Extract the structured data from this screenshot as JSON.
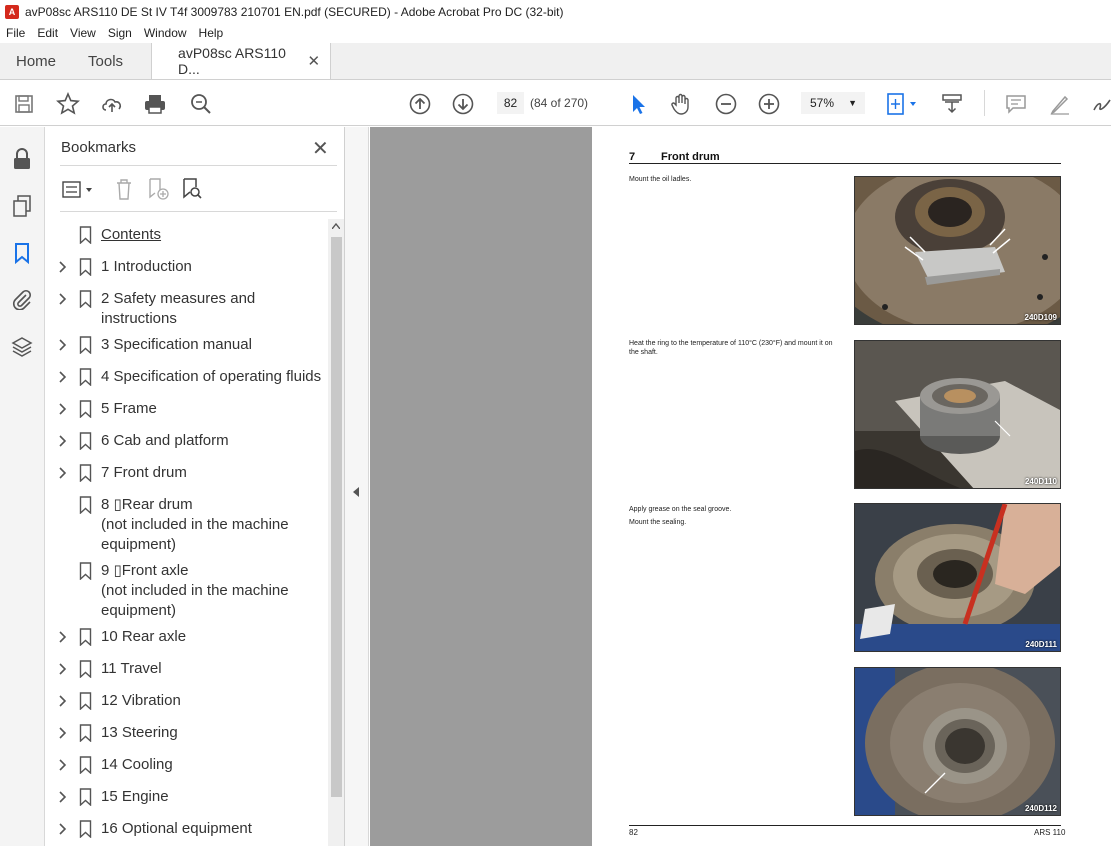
{
  "window": {
    "title": "avP08sc ARS110 DE St IV T4f 3009783 210701 EN.pdf (SECURED) - Adobe Acrobat Pro DC (32-bit)"
  },
  "menu": [
    "File",
    "Edit",
    "View",
    "Sign",
    "Window",
    "Help"
  ],
  "tabs": {
    "home": "Home",
    "tools": "Tools",
    "document": "avP08sc ARS110 D..."
  },
  "toolbar": {
    "page_number": "82",
    "page_count": "(84 of 270)",
    "zoom": "57%"
  },
  "bookmarks": {
    "title": "Bookmarks",
    "items": [
      {
        "label": "Contents",
        "expandable": false,
        "underline": true
      },
      {
        "label": "1 Introduction",
        "expandable": true
      },
      {
        "label": "2 Safety measures and\ninstructions",
        "expandable": true
      },
      {
        "label": "3 Specification manual",
        "expandable": true
      },
      {
        "label": "4 Specification of operating fluids",
        "expandable": true
      },
      {
        "label": "5 Frame",
        "expandable": true
      },
      {
        "label": "6 Cab and platform",
        "expandable": true
      },
      {
        "label": "7 Front drum",
        "expandable": true
      },
      {
        "label": "8 ▯Rear drum\n(not included in the machine\nequipment)",
        "expandable": false
      },
      {
        "label": "9 ▯Front axle\n(not included in the machine\nequipment)",
        "expandable": false
      },
      {
        "label": "10 Rear axle",
        "expandable": true
      },
      {
        "label": "11 Travel",
        "expandable": true
      },
      {
        "label": "12 Vibration",
        "expandable": true
      },
      {
        "label": "13 Steering",
        "expandable": true
      },
      {
        "label": "14 Cooling",
        "expandable": true
      },
      {
        "label": "15 Engine",
        "expandable": true
      },
      {
        "label": "16 Optional equipment",
        "expandable": true
      }
    ]
  },
  "document_page": {
    "section_number": "7",
    "section_title": "Front drum",
    "steps": [
      {
        "text": "Mount the oil ladles.",
        "photo_code": "240D109"
      },
      {
        "text": "Heat the ring to the temperature of 110°C (230°F) and mount it on the shaft.",
        "photo_code": "240D110"
      },
      {
        "text": "Apply grease on the seal groove.\nMount the sealing.",
        "photo_code": "240D111"
      },
      {
        "text": "",
        "photo_code": "240D112"
      }
    ],
    "footer_left": "82",
    "footer_right": "ARS 110"
  },
  "colors": {
    "accent_blue": "#1a73e8",
    "acrobat_red": "#d4291c",
    "canvas_gray": "#9c9c9c"
  }
}
